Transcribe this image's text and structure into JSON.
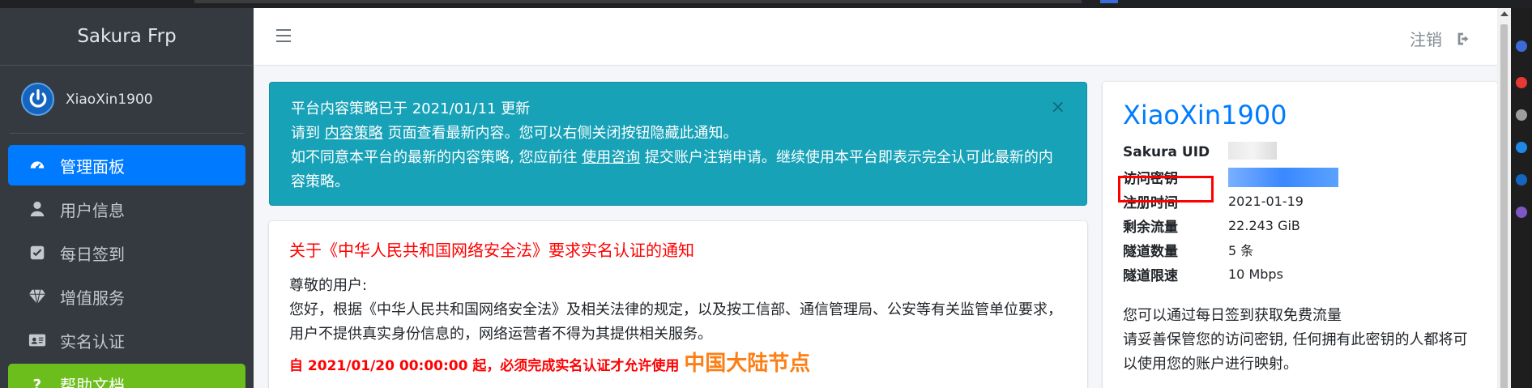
{
  "brand": "Sakura Frp",
  "user": {
    "name": "XiaoXin1900"
  },
  "sidebar": {
    "items": [
      {
        "label": "管理面板",
        "icon": "dashboard-icon",
        "active": true
      },
      {
        "label": "用户信息",
        "icon": "user-icon"
      },
      {
        "label": "每日签到",
        "icon": "checkbox-icon"
      },
      {
        "label": "增值服务",
        "icon": "diamond-icon"
      },
      {
        "label": "实名认证",
        "icon": "id-card-icon"
      },
      {
        "label": "帮助文档",
        "icon": "help-icon"
      }
    ]
  },
  "header": {
    "logout_label": "注销"
  },
  "alert": {
    "line1": "平台内容策略已于 2021/01/11 更新",
    "line2_pre": "请到 ",
    "line2_link": "内容策略",
    "line2_post": " 页面查看最新内容。您可以右侧关闭按钮隐藏此通知。",
    "line3_pre": "如不同意本平台的最新的内容策略, 您应前往 ",
    "line3_link": "使用咨询",
    "line3_post": " 提交账户注销申请。继续使用本平台即表示完全认可此最新的内容策略。",
    "close": "×"
  },
  "notice": {
    "title": "关于《中华人民共和国网络安全法》要求实名认证的通知",
    "greeting": "尊敬的用户:",
    "body": "您好，根据《中华人民共和国网络安全法》及相关法律的规定，以及按工信部、通信管理局、公安等有关监管单位要求，用户不提供真实身份信息的，网络运营者不得为其提供相关服务。",
    "warn": "自 2021/01/20 00:00:00 起，必须完成实名认证才允许使用 ",
    "warn_big": "中国大陆节点"
  },
  "profile": {
    "name": "XiaoXin1900",
    "rows": [
      {
        "key": "Sakura UID",
        "value": ""
      },
      {
        "key": "访问密钥",
        "value": ""
      },
      {
        "key": "注册时间",
        "value": "2021-01-19"
      },
      {
        "key": "剩余流量",
        "value": "22.243 GiB"
      },
      {
        "key": "隧道数量",
        "value": "5 条"
      },
      {
        "key": "隧道限速",
        "value": "10 Mbps"
      }
    ],
    "desc1": "您可以通过每日签到获取免费流量",
    "desc2": "请妥善保管您的访问密钥, 任何拥有此密钥的人都将可以使用您的账户进行映射。"
  },
  "colors": {
    "sidebar_bg": "#343a40",
    "active_nav": "#007bff",
    "alert_bg": "#17a2b8",
    "notice_title": "#ff0000",
    "accent_name": "#007bff",
    "highlight_box": "#ff0000"
  }
}
